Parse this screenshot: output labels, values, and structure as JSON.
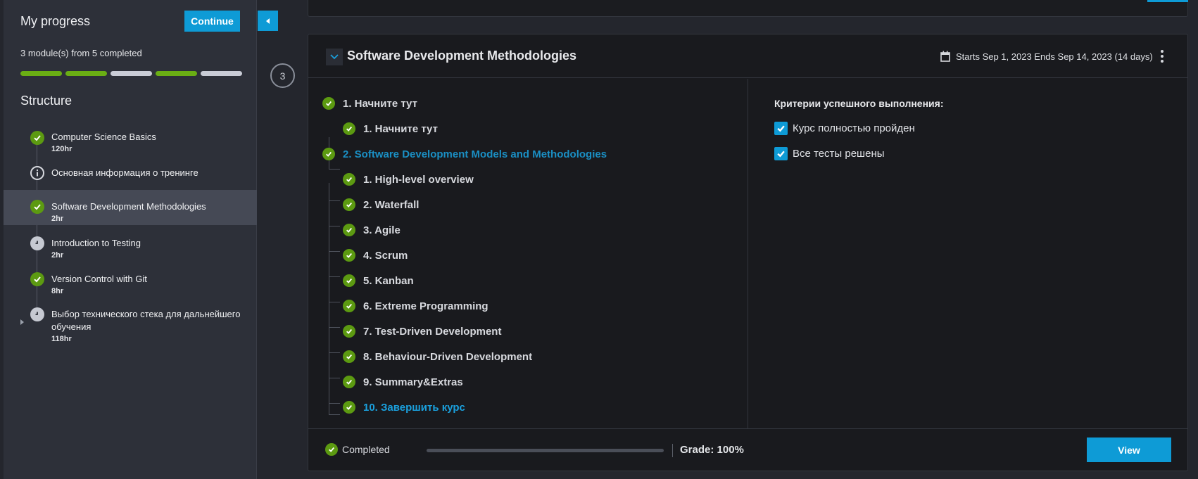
{
  "sidebar": {
    "title": "My progress",
    "continue_label": "Continue",
    "summary": "3 module(s) from 5 completed",
    "segments": [
      "done",
      "done",
      "todo",
      "done",
      "todo"
    ],
    "structure_title": "Structure",
    "modules": [
      {
        "title": "Computer Science Basics",
        "hours": "120hr",
        "status": "check-icon"
      },
      {
        "title": "Основная информация о тренинге",
        "hours": "",
        "status": "info-icon"
      },
      {
        "title": "Software Development Methodologies",
        "hours": "2hr",
        "status": "check-icon"
      },
      {
        "title": "Introduction to Testing",
        "hours": "2hr",
        "status": "clock-icon"
      },
      {
        "title": "Version Control with Git",
        "hours": "8hr",
        "status": "check-icon"
      },
      {
        "title": "Выбор технического стека для дальнейшего обучения",
        "hours": "118hr",
        "status": "clock-icon"
      }
    ]
  },
  "main": {
    "step_number": "3",
    "card": {
      "title": "Software Development Methodologies",
      "dates": "Starts Sep 1, 2023 Ends Sep 14, 2023 (14 days)",
      "lessons": [
        {
          "label": "1. Начните тут",
          "level": 0
        },
        {
          "label": "1. Начните тут",
          "level": 1
        },
        {
          "label": "2. Software Development Models and Methodologies",
          "level": 0
        },
        {
          "label": "1. High-level overview",
          "level": 1
        },
        {
          "label": "2. Waterfall",
          "level": 1
        },
        {
          "label": "3. Agile",
          "level": 1
        },
        {
          "label": "4. Scrum",
          "level": 1
        },
        {
          "label": "5. Kanban",
          "level": 1
        },
        {
          "label": "6. Extreme Programming",
          "level": 1
        },
        {
          "label": "7. Test-Driven Development",
          "level": 1
        },
        {
          "label": "8. Behaviour-Driven Development",
          "level": 1
        },
        {
          "label": "9. Summary&Extras",
          "level": 1
        },
        {
          "label": "10. Завершить курс",
          "level": 1
        }
      ],
      "criteria_title": "Критерии успешного выполнения:",
      "criteria": [
        "Курс полностью пройден",
        "Все тесты решены"
      ],
      "footer": {
        "status": "Completed",
        "progress": 1.0,
        "grade": "Grade: 100%",
        "view_label": "View"
      }
    }
  },
  "colors": {
    "accent": "#0e9bd6",
    "success": "#5c9a11",
    "progress_done": "#6aae14"
  }
}
